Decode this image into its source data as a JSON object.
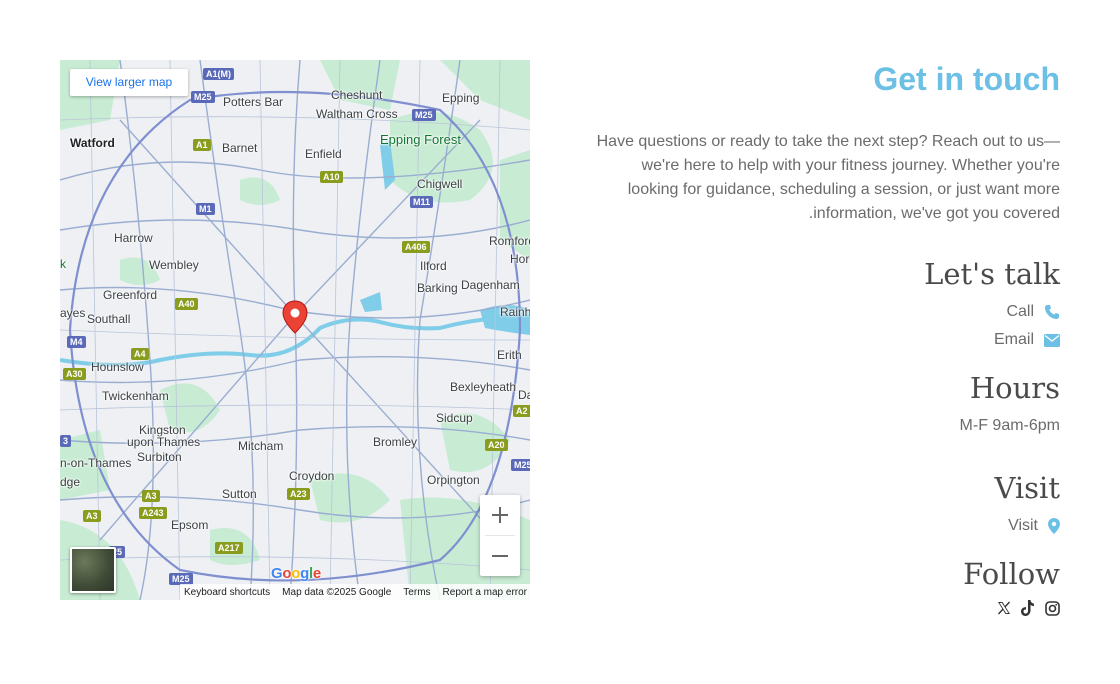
{
  "map": {
    "view_larger_label": "View larger map",
    "places": {
      "potters_bar": "Potters Bar",
      "cheshunt": "Cheshunt",
      "epping": "Epping",
      "watford": "Watford",
      "waltham_cross": "Waltham Cross",
      "barnet": "Barnet",
      "enfield": "Enfield",
      "epping_forest": "Epping Forest",
      "chigwell": "Chigwell",
      "harrow": "Harrow",
      "romford": "Romford",
      "wembley": "Wembley",
      "ilford": "Ilford",
      "hor": "Hor",
      "greenford": "Greenford",
      "barking": "Barking",
      "dagenham": "Dagenham",
      "ayes": "ayes",
      "southall": "Southall",
      "rainh": "Rainh",
      "hounslow": "Hounslow",
      "erith": "Erith",
      "bexleyheath": "Bexleyheath",
      "twickenham": "Twickenham",
      "da": "Da",
      "sidcup": "Sidcup",
      "kingston": "Kingston",
      "upon_thames": "upon Thames",
      "mitcham": "Mitcham",
      "bromley": "Bromley",
      "surbiton": "Surbiton",
      "on_thames": "n-on-Thames",
      "croydon": "Croydon",
      "orpington": "Orpington",
      "dge": "dge",
      "sutton": "Sutton",
      "epsom": "Epsom",
      "k": "k"
    },
    "shields": {
      "a1m": "A1(M)",
      "m25_nw": "M25",
      "m25_ne": "M25",
      "a1": "A1",
      "a10": "A10",
      "m1": "M1",
      "m11": "M11",
      "a406": "A406",
      "a40": "A40",
      "m4": "M4",
      "a4": "A4",
      "a30": "A30",
      "a2": "A2",
      "a20": "A20",
      "m25_e": "M25",
      "n3": "3",
      "a3": "A3",
      "a243": "A243",
      "a23": "A23",
      "a3_w": "A3",
      "n25": "25",
      "a217": "A217",
      "m25_s": "M25"
    },
    "google_logo": [
      "G",
      "o",
      "o",
      "g",
      "l",
      "e"
    ],
    "attribution": {
      "shortcuts": "Keyboard shortcuts",
      "map_data": "Map data ©2025 Google",
      "terms": "Terms",
      "report": "Report a map error"
    },
    "colors": {
      "water": "#7fcde8",
      "park": "#c8ecd3",
      "road": "#8fa3c9",
      "marker": "#ea4335"
    }
  },
  "contact": {
    "title": "Get in touch",
    "intro": "Have questions or ready to take the next step? Reach out to us—we're here to help with your fitness journey. Whether you're looking for guidance, scheduling a session, or just want more information, we've got you covered.",
    "talk_heading": "Let's talk",
    "call_label": "Call",
    "email_label": "Email",
    "hours_heading": "Hours",
    "hours_value": "M-F 9am-6pm",
    "visit_heading": "Visit",
    "visit_label": "Visit",
    "follow_heading": "Follow",
    "icons": {
      "call": "phone-icon",
      "email": "envelope-icon",
      "visit": "map-pin-icon",
      "social": [
        "x-icon",
        "tiktok-icon",
        "instagram-icon"
      ]
    },
    "accent_color": "#6cc0e5"
  }
}
